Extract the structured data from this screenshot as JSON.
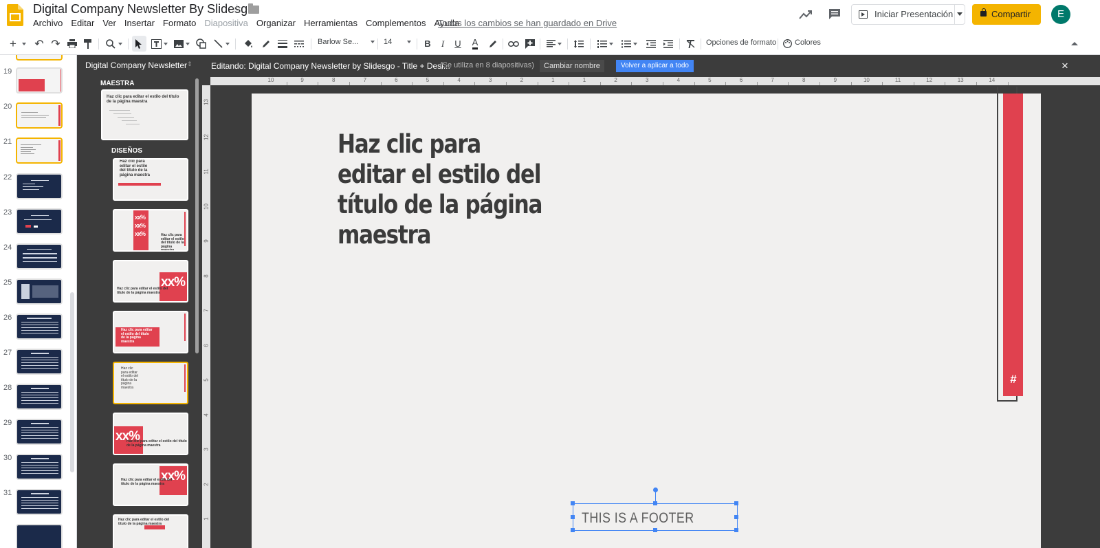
{
  "header": {
    "doc_title": "Digital Company Newsletter By Slidesgo",
    "saved_status": "Todos los cambios se han guardado en Drive",
    "present_label": "Iniciar Presentación",
    "share_label": "Compartir",
    "avatar_letter": "E"
  },
  "menu": [
    "Archivo",
    "Editar",
    "Ver",
    "Insertar",
    "Formato",
    "Diapositiva",
    "Organizar",
    "Herramientas",
    "Complementos",
    "Ayuda"
  ],
  "toolbar": {
    "font_name": "Barlow Se...",
    "font_size": "14",
    "bold": "B",
    "italic": "I",
    "underline": "U",
    "text_color": "A",
    "format_options": "Opciones de formato",
    "colors": "Colores"
  },
  "filmstrip": {
    "slide_numbers": [
      "19",
      "20",
      "21",
      "22",
      "23",
      "24",
      "25",
      "26",
      "27",
      "28",
      "29",
      "30",
      "31"
    ]
  },
  "layout_panel": {
    "title": "Digital Company Newsletter",
    "master_section": "MAESTRA",
    "layouts_section": "DISEÑOS",
    "thumb_title_short": "Haz clic para editar el estilo del título de la página maestra",
    "thumb_title_wrapped": "Haz clic para editar el estilo del título de la página maestra",
    "percent": "xx%"
  },
  "edit_bar": {
    "editing_text": "Editando: Digital Company Newsletter by Slidesgo - Title + Desi...",
    "usage_text": "(Se utiliza en 8 diapositivas)",
    "rename_button": "Cambiar nombre",
    "apply_button": "Volver a aplicar a todo",
    "close": "×"
  },
  "slide": {
    "title": "Haz clic para editar el estilo del título de la página maestra",
    "slide_number_placeholder": "#",
    "footer": "THIS IS A FOOTER"
  },
  "rulers": {
    "horizontal": [
      "10",
      "9",
      "8",
      "7",
      "6",
      "5",
      "4",
      "3",
      "2",
      "1",
      "1",
      "2",
      "3",
      "4",
      "5",
      "6",
      "7",
      "8",
      "9",
      "10",
      "11",
      "12",
      "13",
      "14"
    ],
    "vertical": [
      "13",
      "12",
      "11",
      "10",
      "9",
      "8",
      "7",
      "6",
      "5",
      "4",
      "3",
      "2",
      "1"
    ]
  },
  "colors": {
    "accent_red": "#e0414f",
    "share_yellow": "#f4b400",
    "selection_blue": "#4285f4",
    "panel_dark": "#3c3c3c",
    "avatar_teal": "#00796b"
  }
}
